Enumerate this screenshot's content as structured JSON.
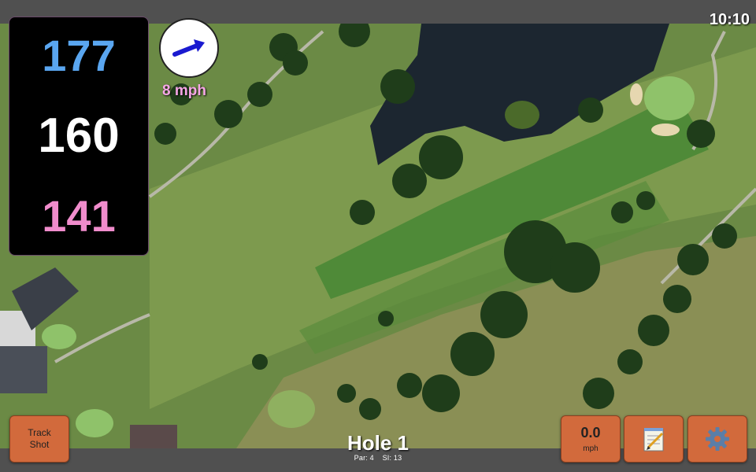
{
  "status": {
    "time": "10:10"
  },
  "distances": {
    "back": "177",
    "middle": "160",
    "front": "141"
  },
  "wind": {
    "speed_label": "8 mph",
    "icon": "wind-arrow-icon"
  },
  "hole": {
    "title": "Hole 1",
    "par": "Par: 4",
    "stroke_index": "SI: 13"
  },
  "buttons": {
    "track_shot_line1": "Track",
    "track_shot_line2": "Shot",
    "speed_value": "0.0",
    "speed_unit": "mph",
    "notes_icon": "notepad-icon",
    "settings_icon": "gear-icon"
  },
  "colors": {
    "back_distance": "#5aa6f0",
    "middle_distance": "#ffffff",
    "front_distance": "#f08ccc",
    "button": "#d26a3c"
  }
}
